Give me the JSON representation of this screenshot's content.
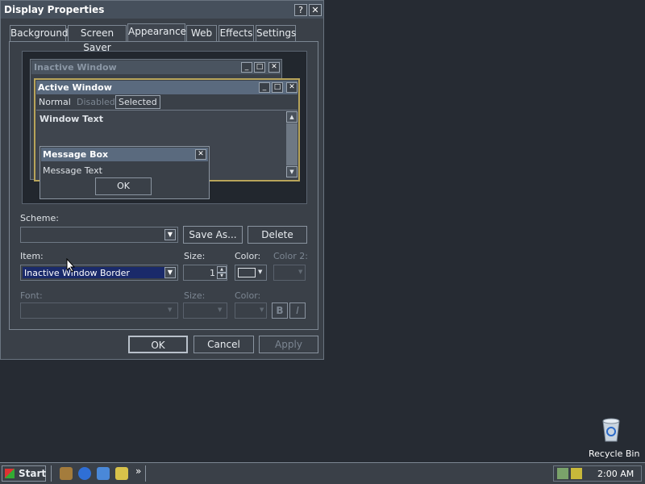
{
  "dialog": {
    "title": "Display Properties",
    "help_btn": "?",
    "close_btn": "✕",
    "tabs": [
      {
        "label": "Background"
      },
      {
        "label": "Screen Saver"
      },
      {
        "label": "Appearance"
      },
      {
        "label": "Web"
      },
      {
        "label": "Effects"
      },
      {
        "label": "Settings"
      }
    ],
    "preview": {
      "inactive_title": "Inactive Window",
      "active_title": "Active Window",
      "menu": {
        "normal": "Normal",
        "disabled": "Disabled",
        "selected": "Selected"
      },
      "window_text": "Window Text",
      "msgbox_title": "Message Box",
      "msgbox_text": "Message Text",
      "msgbox_ok": "OK"
    },
    "scheme_label": "Scheme:",
    "scheme_value": "",
    "save_as": "Save As...",
    "delete": "Delete",
    "item_label": "Item:",
    "item_value": "Inactive Window Border",
    "size_label": "Size:",
    "size_value": "1",
    "color_label": "Color:",
    "color2_label": "Color 2:",
    "font_label": "Font:",
    "font_size_label": "Size:",
    "font_color_label": "Color:",
    "bold_label": "B",
    "italic_label": "I",
    "ok": "OK",
    "cancel": "Cancel",
    "apply": "Apply"
  },
  "desktop": {
    "recycle_bin": "Recycle Bin"
  },
  "taskbar": {
    "start": "Start",
    "chevron": "»",
    "clock": "2:00 AM"
  },
  "colors": {
    "desktop": "#262b33",
    "window": "#3a4048",
    "selection": "#1a2a6a",
    "border_yellow": "#b8a45a"
  }
}
